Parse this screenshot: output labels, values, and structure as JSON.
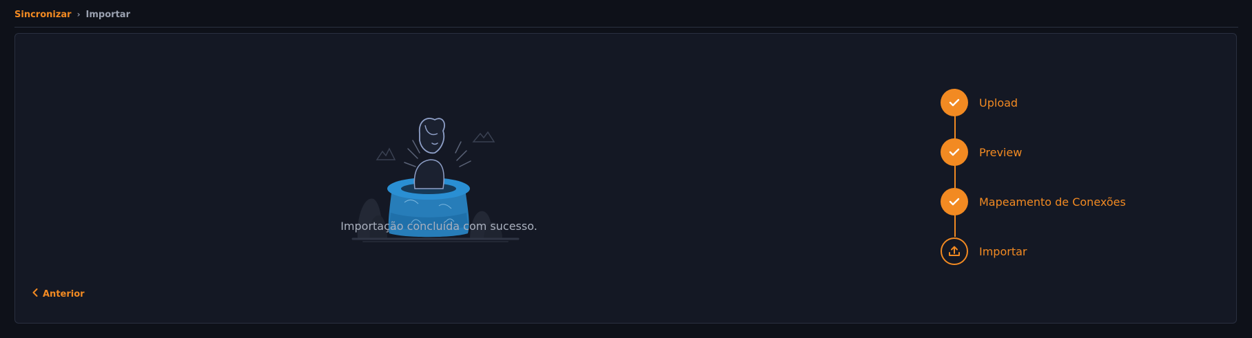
{
  "breadcrumb": {
    "items": [
      {
        "label": "Sincronizar"
      },
      {
        "label": "Importar"
      }
    ]
  },
  "main": {
    "message": "Importação concluída com sucesso.",
    "previous_label": "Anterior"
  },
  "stepper": {
    "steps": [
      {
        "label": "Upload",
        "status": "completed",
        "icon": "check-icon"
      },
      {
        "label": "Preview",
        "status": "completed",
        "icon": "check-icon"
      },
      {
        "label": "Mapeamento de Conexões",
        "status": "completed",
        "icon": "check-icon"
      },
      {
        "label": "Importar",
        "status": "current",
        "icon": "upload-icon"
      }
    ]
  },
  "colors": {
    "accent": "#f28a22",
    "background": "#0e1119",
    "panel": "#141824",
    "illustration_blue": "#2a8fd3"
  }
}
